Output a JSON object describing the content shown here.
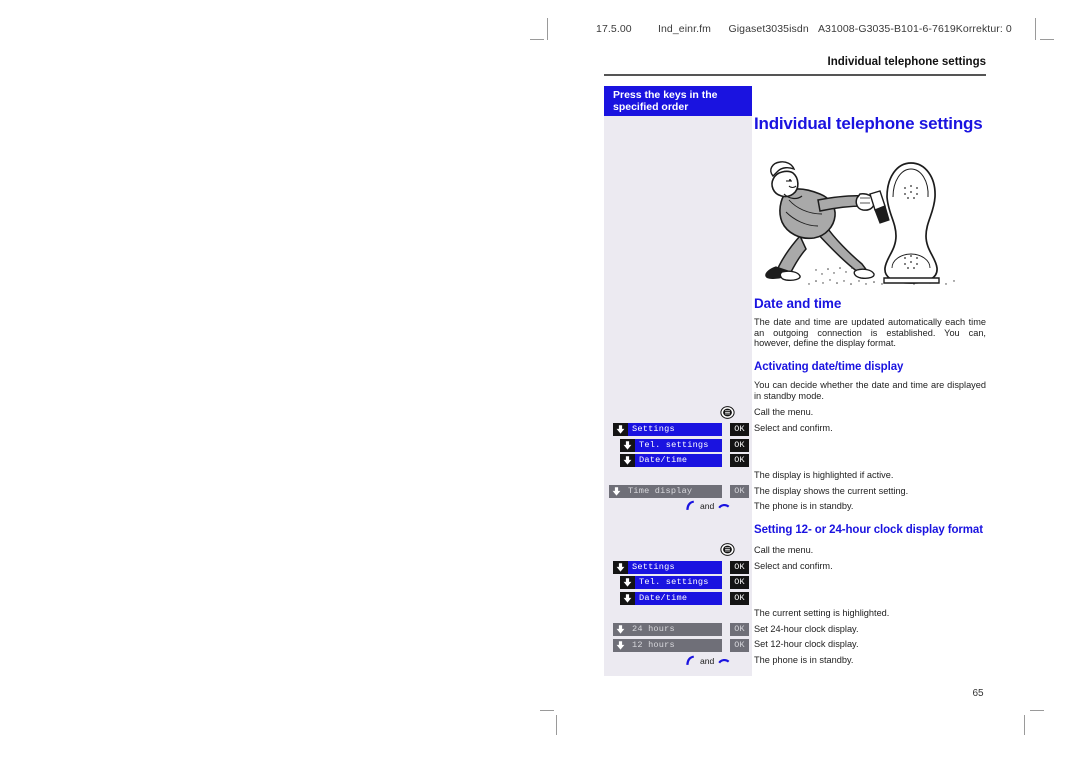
{
  "slug": {
    "date": "17.5.00",
    "file": "Ind_einr.fm",
    "product": "Gigaset3035isdn",
    "order": "A31008-G3035-B101-6-7619",
    "correction": "Korrektur: 0"
  },
  "running_head": "Individual telephone settings",
  "sidebar": {
    "heading": "Press the keys in the specified order"
  },
  "page_title": "Individual telephone settings",
  "illustration": {
    "name": "man-cleaning-giant-telephone-handset-cartoon"
  },
  "sections": [
    {
      "id": "date-and-time",
      "heading": "Date and time",
      "body": "The date and time are updated automatically each time an outgoing connection is established. You can, however, define the display format."
    },
    {
      "id": "activating-date-time-display",
      "heading": "Activating date/time display",
      "body": "You can decide whether the date and time are displayed in standby mode."
    },
    {
      "id": "clock-display-format",
      "heading": "Setting 12- or 24-hour clock display format"
    }
  ],
  "procedures": [
    {
      "id": "activating-date-time-display",
      "steps": [
        {
          "type": "menu-key",
          "icon": "menu-circle-icon",
          "note": "Call the menu."
        },
        {
          "type": "lcd",
          "arrow": "down-arrow-icon",
          "display": "Settings",
          "confirm": "OK",
          "state": "active",
          "note": "Select and confirm."
        },
        {
          "type": "lcd",
          "arrow": "down-arrow-icon",
          "display": "Tel. settings",
          "confirm": "OK",
          "state": "active",
          "note": ""
        },
        {
          "type": "lcd",
          "arrow": "down-arrow-icon",
          "display": "Date/time",
          "confirm": "OK",
          "state": "active",
          "note": ""
        },
        {
          "type": "spacer",
          "note": "The display is highlighted if active."
        },
        {
          "type": "lcd",
          "arrow": "down-arrow-icon",
          "display": "Time display",
          "confirm": "OK",
          "state": "dim",
          "note": "The display shows the current setting."
        },
        {
          "type": "handset",
          "icons": [
            "handset-lift-icon",
            "handset-hangup-icon"
          ],
          "conjunction": "and",
          "note": "The phone is in standby."
        }
      ]
    },
    {
      "id": "clock-display-format",
      "steps": [
        {
          "type": "menu-key",
          "icon": "menu-circle-icon",
          "note": "Call the menu."
        },
        {
          "type": "lcd",
          "arrow": "down-arrow-icon",
          "display": "Settings",
          "confirm": "OK",
          "state": "active",
          "note": "Select and confirm."
        },
        {
          "type": "lcd",
          "arrow": "down-arrow-icon",
          "display": "Tel. settings",
          "confirm": "OK",
          "state": "active",
          "note": ""
        },
        {
          "type": "lcd",
          "arrow": "down-arrow-icon",
          "display": "Date/time",
          "confirm": "OK",
          "state": "active",
          "note": ""
        },
        {
          "type": "spacer",
          "note": "The current setting is highlighted."
        },
        {
          "type": "lcd",
          "arrow": "down-arrow-icon",
          "display": "24 hours",
          "confirm": "OK",
          "state": "dim",
          "note": "Set 24-hour clock display."
        },
        {
          "type": "lcd",
          "arrow": "down-arrow-icon",
          "display": "12 hours",
          "confirm": "OK",
          "state": "dim",
          "note": "Set 12-hour clock display."
        },
        {
          "type": "handset",
          "icons": [
            "handset-lift-icon",
            "handset-hangup-icon"
          ],
          "conjunction": "and",
          "note": "The phone is in standby."
        }
      ]
    }
  ],
  "folio": "65",
  "colors": {
    "brand_blue": "#1a13e0",
    "panel": "#eceaf1",
    "key_black": "#141414",
    "key_dim": "#6f6f78"
  }
}
